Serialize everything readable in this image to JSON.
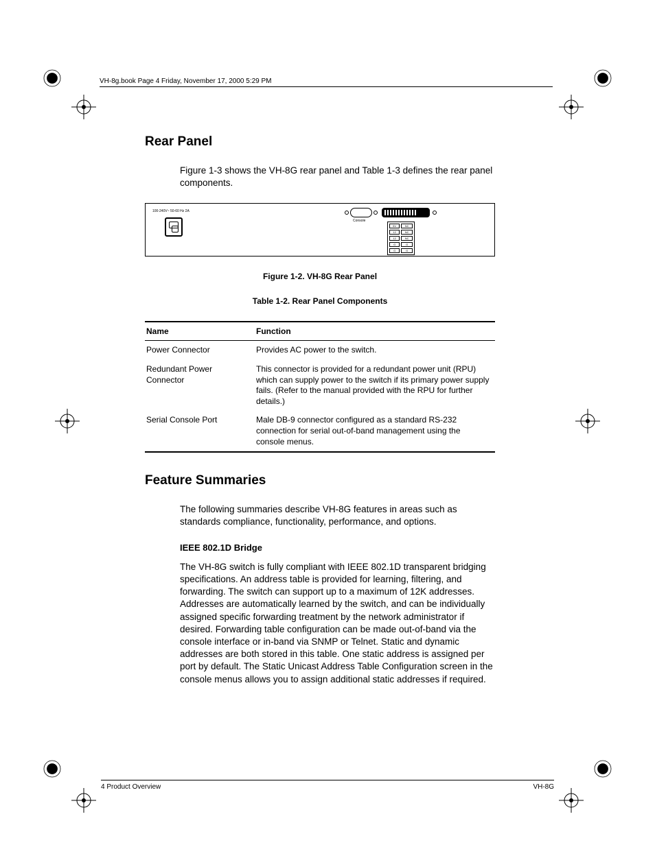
{
  "header": {
    "text": "VH-8g.book  Page 4  Friday, November 17, 2000  5:29 PM"
  },
  "section1": {
    "title": "Rear Panel",
    "intro": "Figure 1-3 shows the VH-8G rear panel and Table 1-3 defines the rear panel components.",
    "figure_caption": "Figure 1-2.  VH-8G Rear Panel",
    "table_caption": "Table 1-2.  Rear Panel Components",
    "figure_labels": {
      "product": "100-240V~ 50-60 Hz 2A",
      "console": "Console"
    }
  },
  "table": {
    "headers": {
      "name": "Name",
      "function": "Function"
    },
    "rows": [
      {
        "name": "Power Connector",
        "function": "Provides AC power to the switch."
      },
      {
        "name": "Redundant Power Connector",
        "function": "This connector is provided for a redundant power unit (RPU) which can supply power to the switch if its primary power supply fails. (Refer to the manual provided with the RPU for further details.)"
      },
      {
        "name": "Serial Console Port",
        "function": "Male DB-9 connector configured as a standard RS-232 connection for serial out-of-band management using the console menus."
      }
    ]
  },
  "section2": {
    "title": "Feature Summaries",
    "intro": "The following summaries describe VH-8G features in areas such as standards compliance, functionality, performance, and options.",
    "sub_title": "IEEE 802.1D Bridge",
    "sub_body": "The VH-8G switch is fully compliant with IEEE 802.1D transparent bridging specifications. An address table is provided for learning, filtering, and forwarding. The switch can support up to a maximum of 12K addresses. Addresses are automatically learned by the switch, and can be individually assigned specific forwarding treatment by the network administrator if desired. Forwarding table configuration can be made out-of-band via the console interface or in-band via SNMP or Telnet. Static and dynamic addresses are both stored in this table. One static address is assigned per port by default. The Static Unicast Address Table Configuration screen in the console menus allows you to assign additional static addresses if required."
  },
  "footer": {
    "left": "4  Product Overview",
    "right": "VH-8G"
  }
}
